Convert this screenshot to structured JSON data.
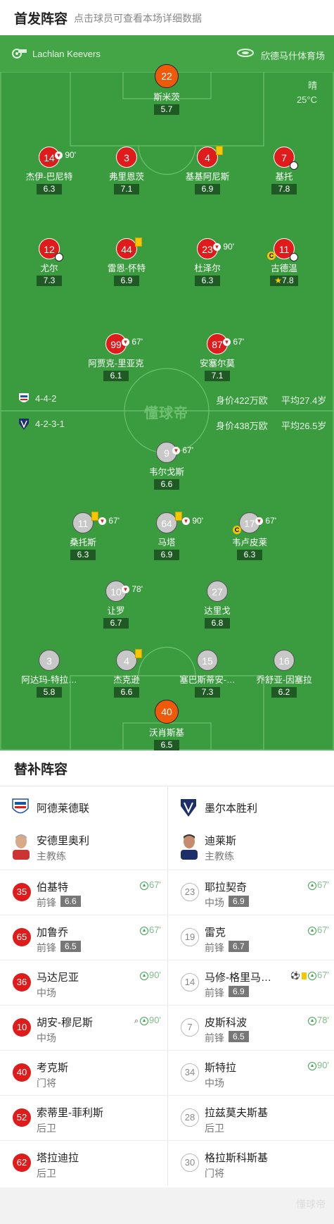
{
  "header": {
    "title": "首发阵容",
    "subtitle": "点击球员可查看本场详细数据"
  },
  "match": {
    "referee": "Lachlan Keevers",
    "stadium": "欣德马什体育场",
    "weather": "晴",
    "temperature": "25°C"
  },
  "watermark": "懂球帝",
  "home_team": {
    "name": "阿德莱德联",
    "formation": "4-4-2",
    "value": "身价422万欧",
    "age": "平均27.4岁",
    "color": "#e01b1b"
  },
  "away_team": {
    "name": "墨尔本胜利",
    "formation": "4-2-3-1",
    "value": "身价438万欧",
    "age": "平均26.5岁",
    "color": "#c8c8c8"
  },
  "home_players": [
    {
      "num": "22",
      "name": "斯米茨",
      "rating": "5.7"
    },
    {
      "num": "14",
      "name": "杰伊-巴尼特",
      "rating": "6.3",
      "sub": "90'"
    },
    {
      "num": "3",
      "name": "弗里恩茨",
      "rating": "7.1"
    },
    {
      "num": "4",
      "name": "基基阿尼斯",
      "rating": "6.9"
    },
    {
      "num": "7",
      "name": "基托",
      "rating": "7.8"
    },
    {
      "num": "12",
      "name": "尤尔",
      "rating": "7.3"
    },
    {
      "num": "44",
      "name": "雷恩-怀特",
      "rating": "6.9"
    },
    {
      "num": "23",
      "name": "杜泽尔",
      "rating": "6.3",
      "sub": "90'"
    },
    {
      "num": "11",
      "name": "古德温",
      "rating": "7.8"
    },
    {
      "num": "99",
      "name": "阿贾克-里亚克",
      "rating": "6.1",
      "sub": "67'"
    },
    {
      "num": "87",
      "name": "安塞尔莫",
      "rating": "7.1",
      "sub": "67'"
    }
  ],
  "away_players": [
    {
      "num": "9",
      "name": "韦尔戈斯",
      "rating": "6.6",
      "sub": "67'"
    },
    {
      "num": "11",
      "name": "桑托斯",
      "rating": "6.3",
      "sub": "67'"
    },
    {
      "num": "64",
      "name": "马塔",
      "rating": "6.9",
      "sub": "90'"
    },
    {
      "num": "17",
      "name": "韦卢皮莱",
      "rating": "6.3",
      "sub": "67'"
    },
    {
      "num": "10",
      "name": "让罗",
      "rating": "6.7",
      "sub": "78'"
    },
    {
      "num": "27",
      "name": "达里戈",
      "rating": "6.8"
    },
    {
      "num": "3",
      "name": "阿达玛-特拉…",
      "rating": "5.8"
    },
    {
      "num": "4",
      "name": "杰克逊",
      "rating": "6.6"
    },
    {
      "num": "15",
      "name": "塞巴斯蒂安-…",
      "rating": "7.3"
    },
    {
      "num": "16",
      "name": "乔舒亚-因塞拉",
      "rating": "6.2"
    },
    {
      "num": "40",
      "name": "沃肖斯基",
      "rating": "6.5"
    }
  ],
  "subs_section": {
    "title": "替补阵容",
    "home": {
      "team": "阿德莱德联",
      "coach": {
        "name": "安德里奥利",
        "role": "主教练"
      },
      "players": [
        {
          "num": "35",
          "name": "伯基特",
          "pos": "前锋",
          "rating": "6.6",
          "min": "67'"
        },
        {
          "num": "65",
          "name": "加鲁乔",
          "pos": "前锋",
          "rating": "6.5",
          "min": "67'"
        },
        {
          "num": "36",
          "name": "马达尼亚",
          "pos": "中场",
          "rating": "",
          "min": "90'"
        },
        {
          "num": "10",
          "name": "胡安-穆尼斯",
          "pos": "中场",
          "rating": "",
          "min": "90'"
        },
        {
          "num": "40",
          "name": "考克斯",
          "pos": "门将",
          "rating": "",
          "min": ""
        },
        {
          "num": "52",
          "name": "索蒂里-菲利斯",
          "pos": "后卫",
          "rating": "",
          "min": ""
        },
        {
          "num": "62",
          "name": "塔拉迪拉",
          "pos": "后卫",
          "rating": "",
          "min": ""
        }
      ]
    },
    "away": {
      "team": "墨尔本胜利",
      "coach": {
        "name": "迪莱斯",
        "role": "主教练"
      },
      "players": [
        {
          "num": "23",
          "name": "耶拉契奇",
          "pos": "中场",
          "rating": "6.9",
          "min": "67'"
        },
        {
          "num": "19",
          "name": "雷克",
          "pos": "前锋",
          "rating": "6.7",
          "min": "67'"
        },
        {
          "num": "14",
          "name": "马修-格里马…",
          "pos": "前锋",
          "rating": "6.9",
          "min": "67'"
        },
        {
          "num": "7",
          "name": "皮斯科波",
          "pos": "前锋",
          "rating": "6.5",
          "min": "78'"
        },
        {
          "num": "34",
          "name": "斯特拉",
          "pos": "中场",
          "rating": "",
          "min": "90'"
        },
        {
          "num": "28",
          "name": "拉兹莫夫斯基",
          "pos": "后卫",
          "rating": "",
          "min": ""
        },
        {
          "num": "30",
          "name": "格拉斯科斯基",
          "pos": "门将",
          "rating": "",
          "min": ""
        }
      ]
    }
  },
  "footer": {
    "watermark": "懂球帝"
  }
}
